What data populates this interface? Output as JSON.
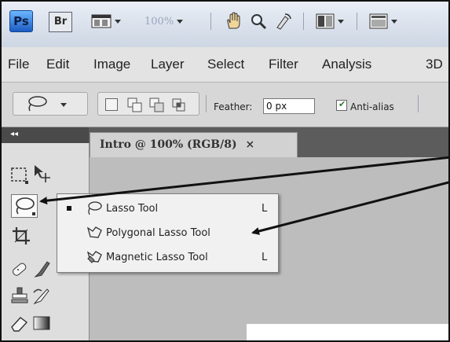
{
  "app_bar": {
    "logo_text": "Ps",
    "bridge_text": "Br",
    "zoom_text": "100%"
  },
  "menu_bar": {
    "items": [
      "File",
      "Edit",
      "Image",
      "Layer",
      "Select",
      "Filter",
      "Analysis",
      "3D"
    ]
  },
  "options_bar": {
    "feather_label": "Feather:",
    "feather_value": "0 px",
    "anti_alias_label": "Anti-alias",
    "anti_alias_checked": true
  },
  "document": {
    "tab_title": "Intro @ 100% (RGB/8)",
    "close_glyph": "×"
  },
  "toolbox": {
    "collapse_glyph": "◂◂"
  },
  "flyout": {
    "items": [
      {
        "label": "Lasso Tool",
        "shortcut": "L",
        "icon": "lasso-icon",
        "selected": true
      },
      {
        "label": "Polygonal Lasso Tool",
        "shortcut": "",
        "icon": "polygonal-lasso-icon",
        "selected": false
      },
      {
        "label": "Magnetic Lasso Tool",
        "shortcut": "L",
        "icon": "magnetic-lasso-icon",
        "selected": false
      }
    ]
  },
  "colors": {
    "annotation_arrow": "#111111",
    "canvas": "#bdbdbd",
    "panel_dark": "#5c5c5c"
  }
}
